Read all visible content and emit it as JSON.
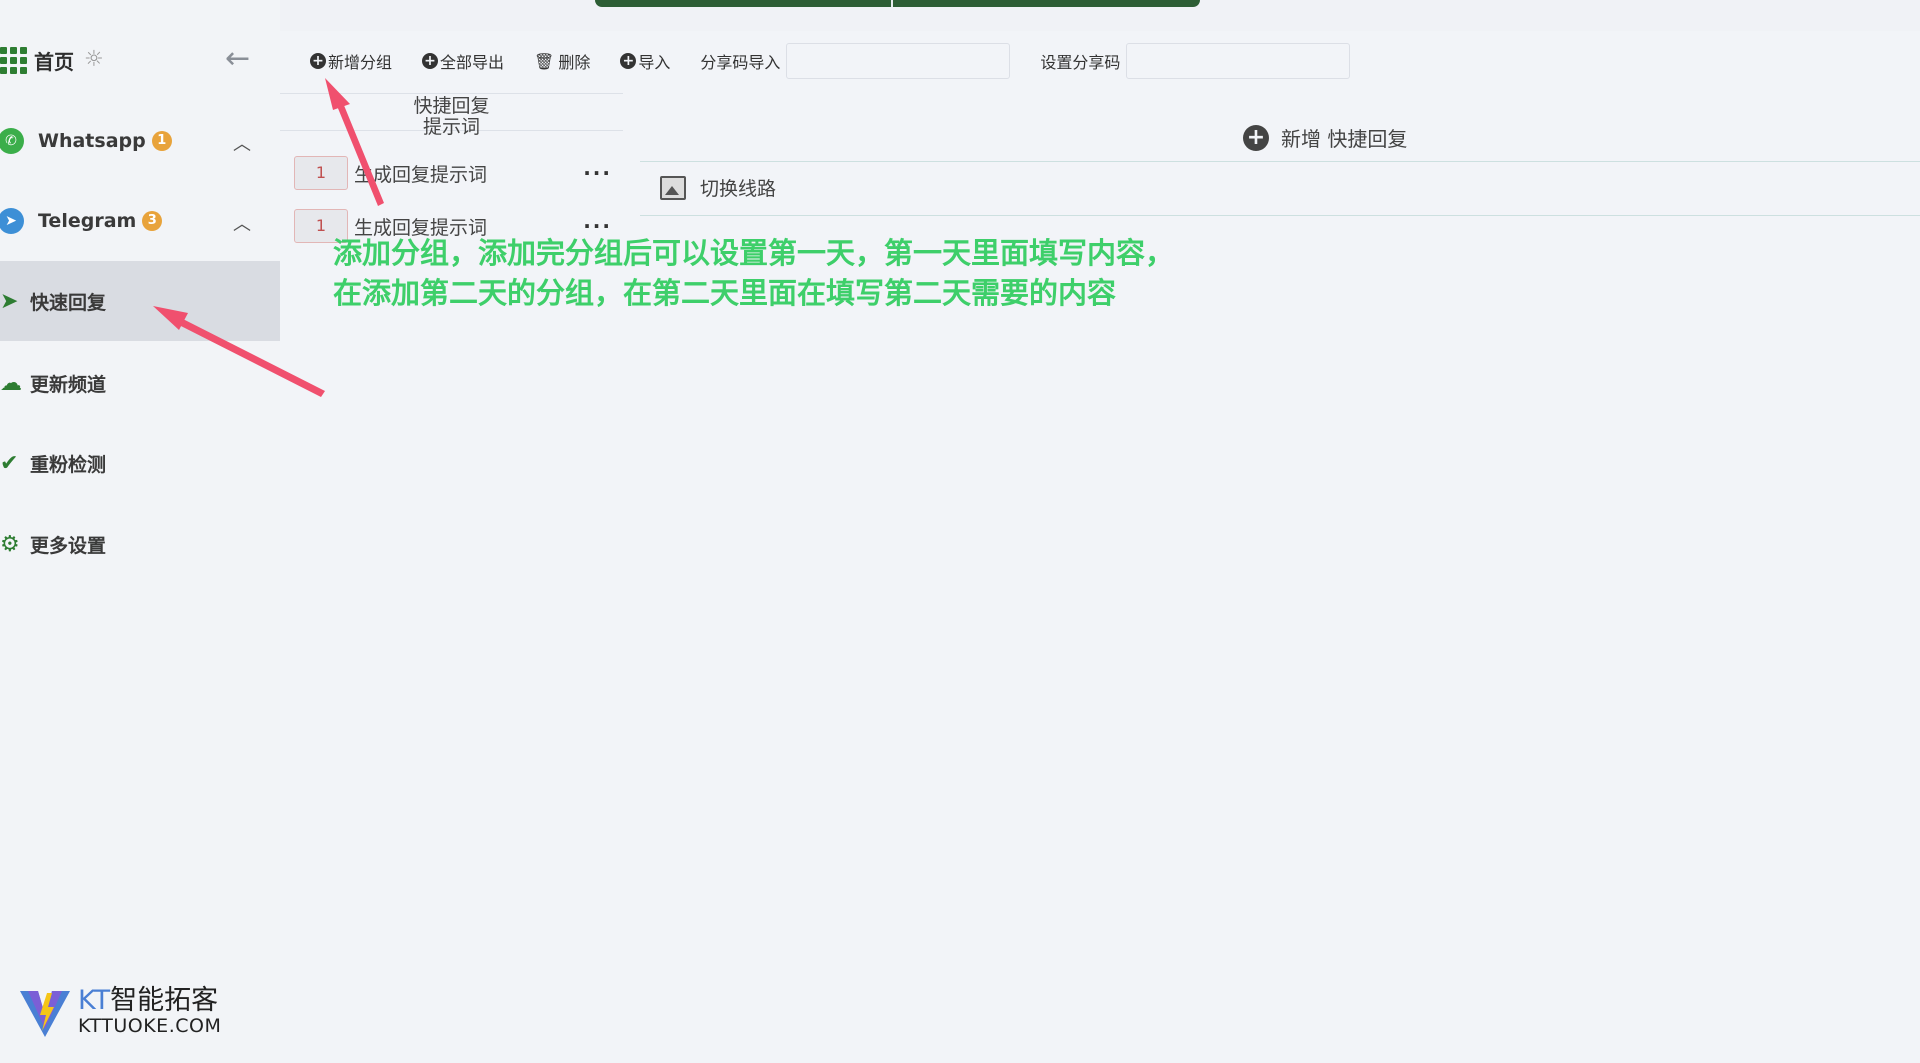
{
  "sidebar": {
    "home_label": "首页",
    "items": [
      {
        "label": "Whatsapp",
        "badge": "1"
      },
      {
        "label": "Telegram",
        "badge": "3"
      },
      {
        "label": "快速回复"
      },
      {
        "label": "更新频道"
      },
      {
        "label": "重粉检测"
      },
      {
        "label": "更多设置"
      }
    ]
  },
  "logo": {
    "line1_brand": "KT",
    "line1_name": "智能拓客",
    "line2": "KTTUOKE.COM"
  },
  "toolbar": {
    "add_group": "新增分组",
    "export_all": "全部导出",
    "delete": "删除",
    "import": "导入",
    "share_import_label": "分享码导入",
    "share_import_value": "",
    "set_share_label": "设置分享码",
    "set_share_value": ""
  },
  "group_header": {
    "line1": "快捷回复",
    "line2": "提示词"
  },
  "groups": [
    {
      "num": "1",
      "label": "生成回复提示词"
    },
    {
      "num": "1",
      "label": "生成回复提示词"
    }
  ],
  "content": {
    "add_reply": "新增 快捷回复",
    "switch_line": "切换线路"
  },
  "annotation": {
    "line1": "添加分组，添加完分组后可以设置第一天，第一天里面填写内容，",
    "line2": "在添加第二天的分组，在第二天里面在填写第二天需要的内容"
  },
  "colors": {
    "accent_green": "#2e7d32",
    "annotation_green": "#3ecf6a",
    "arrow_red": "#f0506e",
    "badge_orange": "#e8a33b"
  }
}
